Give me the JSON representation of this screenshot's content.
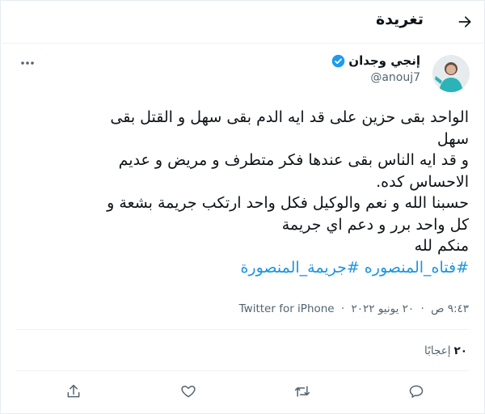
{
  "header": {
    "title": "تغريدة",
    "back_icon": "arrow-right-icon"
  },
  "author": {
    "display_name": "إنجي وجدان",
    "handle": "@anouj7",
    "verified": true,
    "avatar_icon": "avatar-image"
  },
  "tweet": {
    "lines": [
      "الواحد بقى حزين على قد ايه الدم بقى سهل و القتل بقى",
      "سهل",
      "و قد ايه الناس بقى عندها فكر متطرف و مريض و عديم",
      "الاحساس كده.",
      "حسبنا الله و نعم والوكيل فكل واحد ارتكب جريمة بشعة و",
      "كل واحد برر و دعم اي جريمة",
      "منكم لله"
    ],
    "hashtags": "#فتاه_المنصوره #جريمة_المنصورة"
  },
  "meta": {
    "time": "٩:٤٣ ص",
    "date": "٢٠ يونيو ٢٠٢٢",
    "source": "Twitter for iPhone",
    "separator": "·"
  },
  "stats": {
    "likes_count": "٢٠",
    "likes_label": "إعجابًا"
  },
  "actions": [
    "share-icon",
    "like-icon",
    "retweet-icon",
    "reply-icon"
  ],
  "colors": {
    "link": "#1b95e0",
    "secondary": "#536471",
    "verified": "#1d9bf0"
  }
}
